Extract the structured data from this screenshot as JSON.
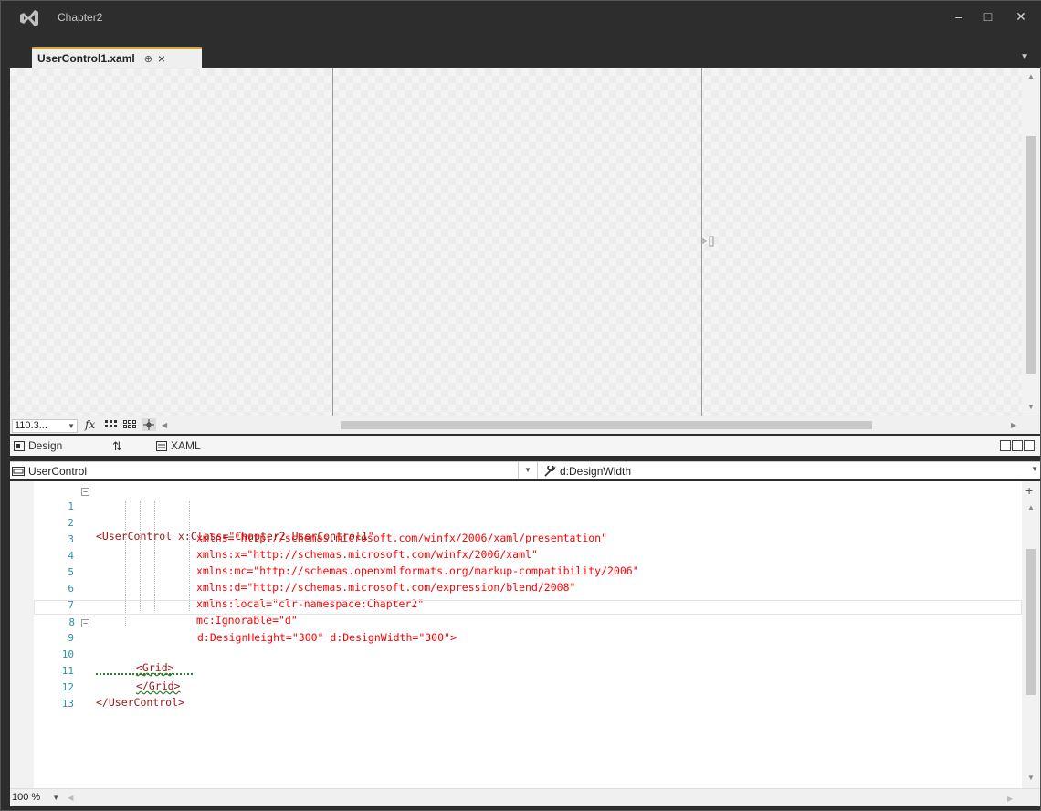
{
  "window": {
    "title": "Chapter2",
    "minimize": "–",
    "maximize": "□",
    "close": "✕"
  },
  "tabs": [
    {
      "label": "UserControl1.xaml",
      "pin": "⊕",
      "close": "×"
    }
  ],
  "designer": {
    "zoom": "110.3...",
    "fx": "fx"
  },
  "split_tabs": {
    "design": "Design",
    "swap": "⇅",
    "xaml": "XAML"
  },
  "navigation": {
    "left": "UserControl",
    "right": "d:DesignWidth"
  },
  "code_lines": [
    {
      "n": "1",
      "text": "<UserControl x:Class=\"Chapter2.UserControl1\""
    },
    {
      "n": "2",
      "text": "xmlns=\"http://schemas.microsoft.com/winfx/2006/xaml/presentation\""
    },
    {
      "n": "3",
      "text": "xmlns:x=\"http://schemas.microsoft.com/winfx/2006/xaml\""
    },
    {
      "n": "4",
      "text": "xmlns:mc=\"http://schemas.openxmlformats.org/markup-compatibility/2006\""
    },
    {
      "n": "5",
      "text": "xmlns:d=\"http://schemas.microsoft.com/expression/blend/2008\""
    },
    {
      "n": "6",
      "text": "xmlns:local=\"clr-namespace:Chapter2\""
    },
    {
      "n": "7",
      "text": "mc:Ignorable=\"d\""
    },
    {
      "n": "8",
      "text": "d:DesignHeight=\"300\" d:DesignWidth=\"300\">"
    },
    {
      "n": "9",
      "text": "<Grid>"
    },
    {
      "n": "10",
      "text": ""
    },
    {
      "n": "11",
      "text": "</Grid>"
    },
    {
      "n": "12",
      "text": "</UserControl>"
    },
    {
      "n": "13",
      "text": ""
    }
  ],
  "editor_zoom": "100 %"
}
